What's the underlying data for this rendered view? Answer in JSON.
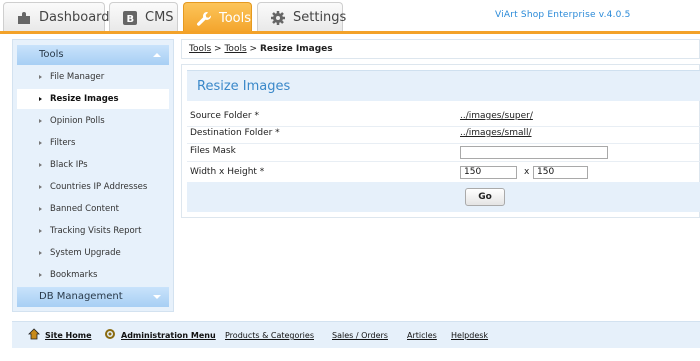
{
  "tabs": [
    {
      "label": "Dashboard",
      "icon": "puzzle-icon",
      "active": false
    },
    {
      "label": "CMS",
      "icon": "cms-icon",
      "active": false
    },
    {
      "label": "Tools",
      "icon": "wrench-icon",
      "active": true
    },
    {
      "label": "Settings",
      "icon": "gear-icon",
      "active": false
    }
  ],
  "brand": "ViArt Shop Enterprise v.4.0.5",
  "sidebar": {
    "tools_header": "Tools",
    "items": [
      {
        "label": "File Manager"
      },
      {
        "label": "Resize Images",
        "active": true
      },
      {
        "label": "Opinion Polls"
      },
      {
        "label": "Filters"
      },
      {
        "label": "Black IPs"
      },
      {
        "label": "Countries IP Addresses"
      },
      {
        "label": "Banned Content"
      },
      {
        "label": "Tracking Visits Report"
      },
      {
        "label": "System Upgrade"
      },
      {
        "label": "Bookmarks"
      }
    ],
    "db_header": "DB Management"
  },
  "breadcrumb": {
    "first": "Tools",
    "second": "Tools",
    "current": "Resize Images",
    "sep": ">"
  },
  "form": {
    "title": "Resize Images",
    "source_label": "Source Folder *",
    "source_value": "../images/super/",
    "dest_label": "Destination Folder *",
    "dest_value": "../images/small/",
    "mask_label": "Files Mask",
    "mask_value": "",
    "wh_label": "Width x Height *",
    "width_value": "150",
    "height_value": "150",
    "x_sep": "x",
    "go_label": "Go"
  },
  "footer": {
    "site_home": "Site Home",
    "admin_menu": "Administration Menu",
    "products": "Products & Categories",
    "sales": "Sales / Orders",
    "articles": "Articles",
    "helpdesk": "Helpdesk"
  },
  "colors": {
    "accent_orange": "#f3a229",
    "sidebar_blue": "#a7cff4",
    "title_blue": "#3a88c9"
  }
}
